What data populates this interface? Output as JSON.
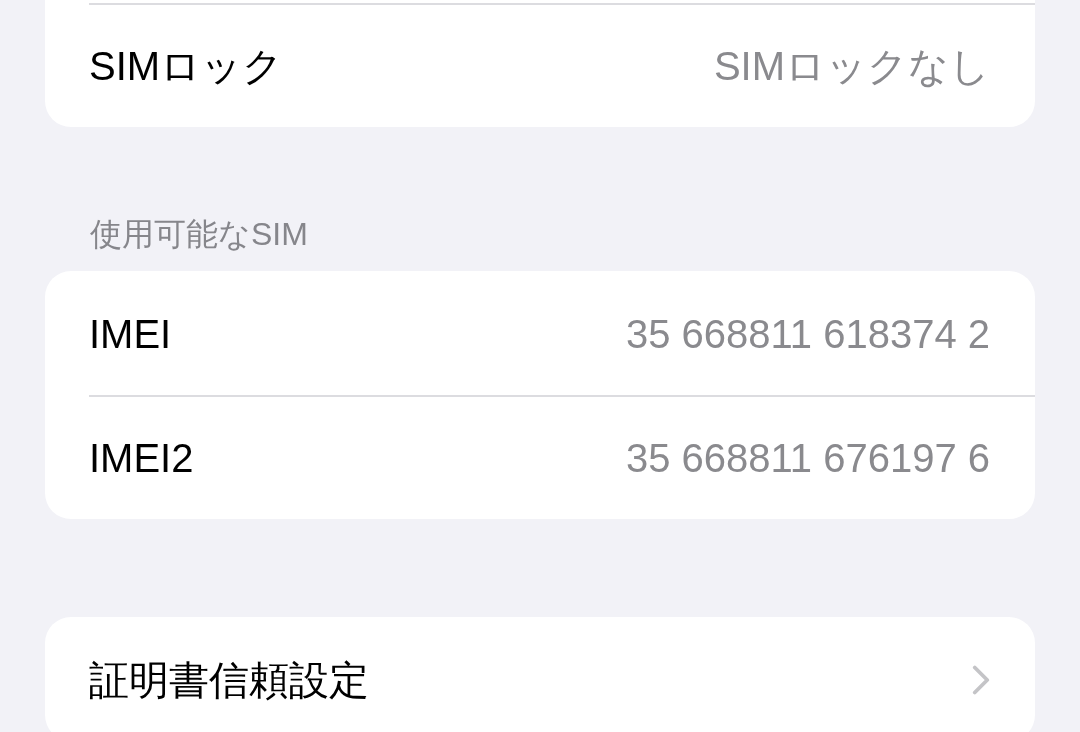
{
  "sections": [
    {
      "cut_top": true,
      "rows": [
        {
          "kind": "value",
          "label": "SIMロック",
          "value": "SIMロックなし"
        }
      ]
    },
    {
      "header": "使用可能なSIM",
      "rows": [
        {
          "kind": "value",
          "label": "IMEI",
          "value": "35 668811 618374 2"
        },
        {
          "kind": "value",
          "label": "IMEI2",
          "value": "35 668811 676197 6"
        }
      ]
    },
    {
      "rows": [
        {
          "kind": "link",
          "label": "証明書信頼設定"
        }
      ]
    }
  ]
}
